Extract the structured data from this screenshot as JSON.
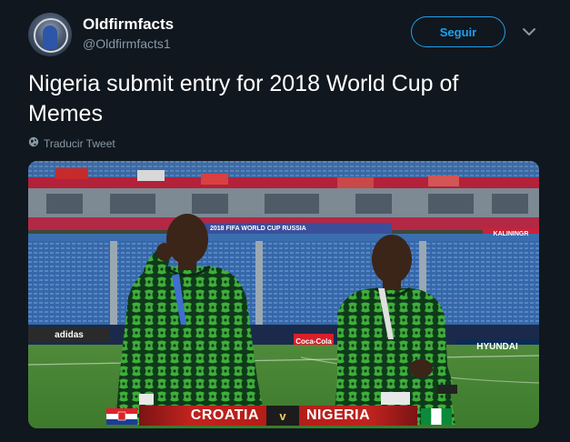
{
  "account": {
    "name": "Oldfirmfacts",
    "handle": "@Oldfirmfacts1"
  },
  "follow_button": {
    "label": "Seguir"
  },
  "tweet": {
    "text_line1": "Nigeria submit entry for 2018 World Cup of",
    "text_line2": "Memes"
  },
  "translate": {
    "label": "Traducir Tweet"
  },
  "media": {
    "scoreboard": {
      "team_left": "CROATIA",
      "vs": "v",
      "team_right": "NIGERIA"
    },
    "banner": "2018 FIFA WORLD CUP RUSSIA",
    "ad_boards": {
      "adidas": "adidas",
      "coca_cola": "Coca-Cola",
      "hyundai": "HYUNDAI",
      "kaliningrad": "KALININGR"
    }
  },
  "colors": {
    "background": "#10171e",
    "accent": "#1da1f2",
    "secondary_text": "#8899a6"
  },
  "icons": [
    "chevron-down-icon",
    "globe-icon"
  ]
}
